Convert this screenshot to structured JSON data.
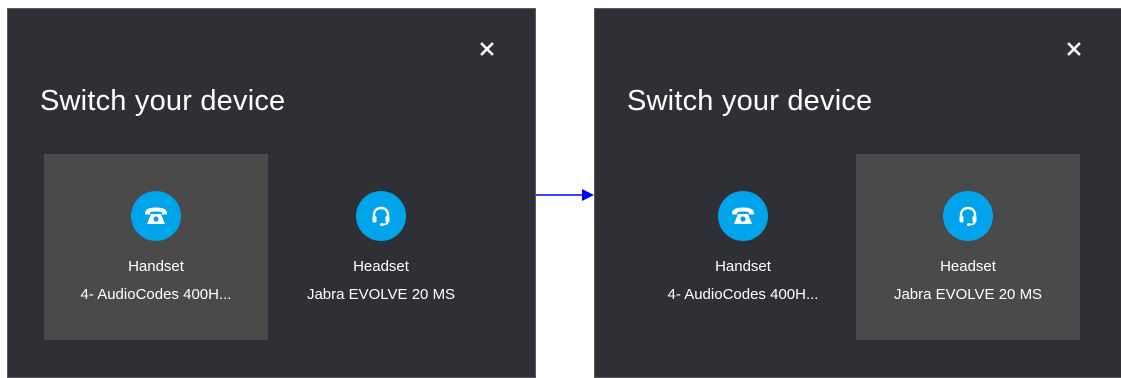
{
  "before": {
    "title": "Switch your device",
    "close_icon": "close-icon",
    "devices": [
      {
        "type": "Handset",
        "name": "4- AudioCodes 400H...",
        "icon": "phone-icon",
        "selected": true
      },
      {
        "type": "Headset",
        "name": "Jabra EVOLVE 20 MS",
        "icon": "headset-icon",
        "selected": false
      }
    ]
  },
  "after": {
    "title": "Switch your device",
    "close_icon": "close-icon",
    "devices": [
      {
        "type": "Handset",
        "name": "4- AudioCodes 400H...",
        "icon": "phone-icon",
        "selected": false
      },
      {
        "type": "Headset",
        "name": "Jabra EVOLVE 20 MS",
        "icon": "headset-icon",
        "selected": true
      }
    ]
  },
  "colors": {
    "panel_bg": "#2e3036",
    "selected_bg": "#4a4a4a",
    "icon_accent": "#00a4ea",
    "arrow": "#0000ff"
  }
}
